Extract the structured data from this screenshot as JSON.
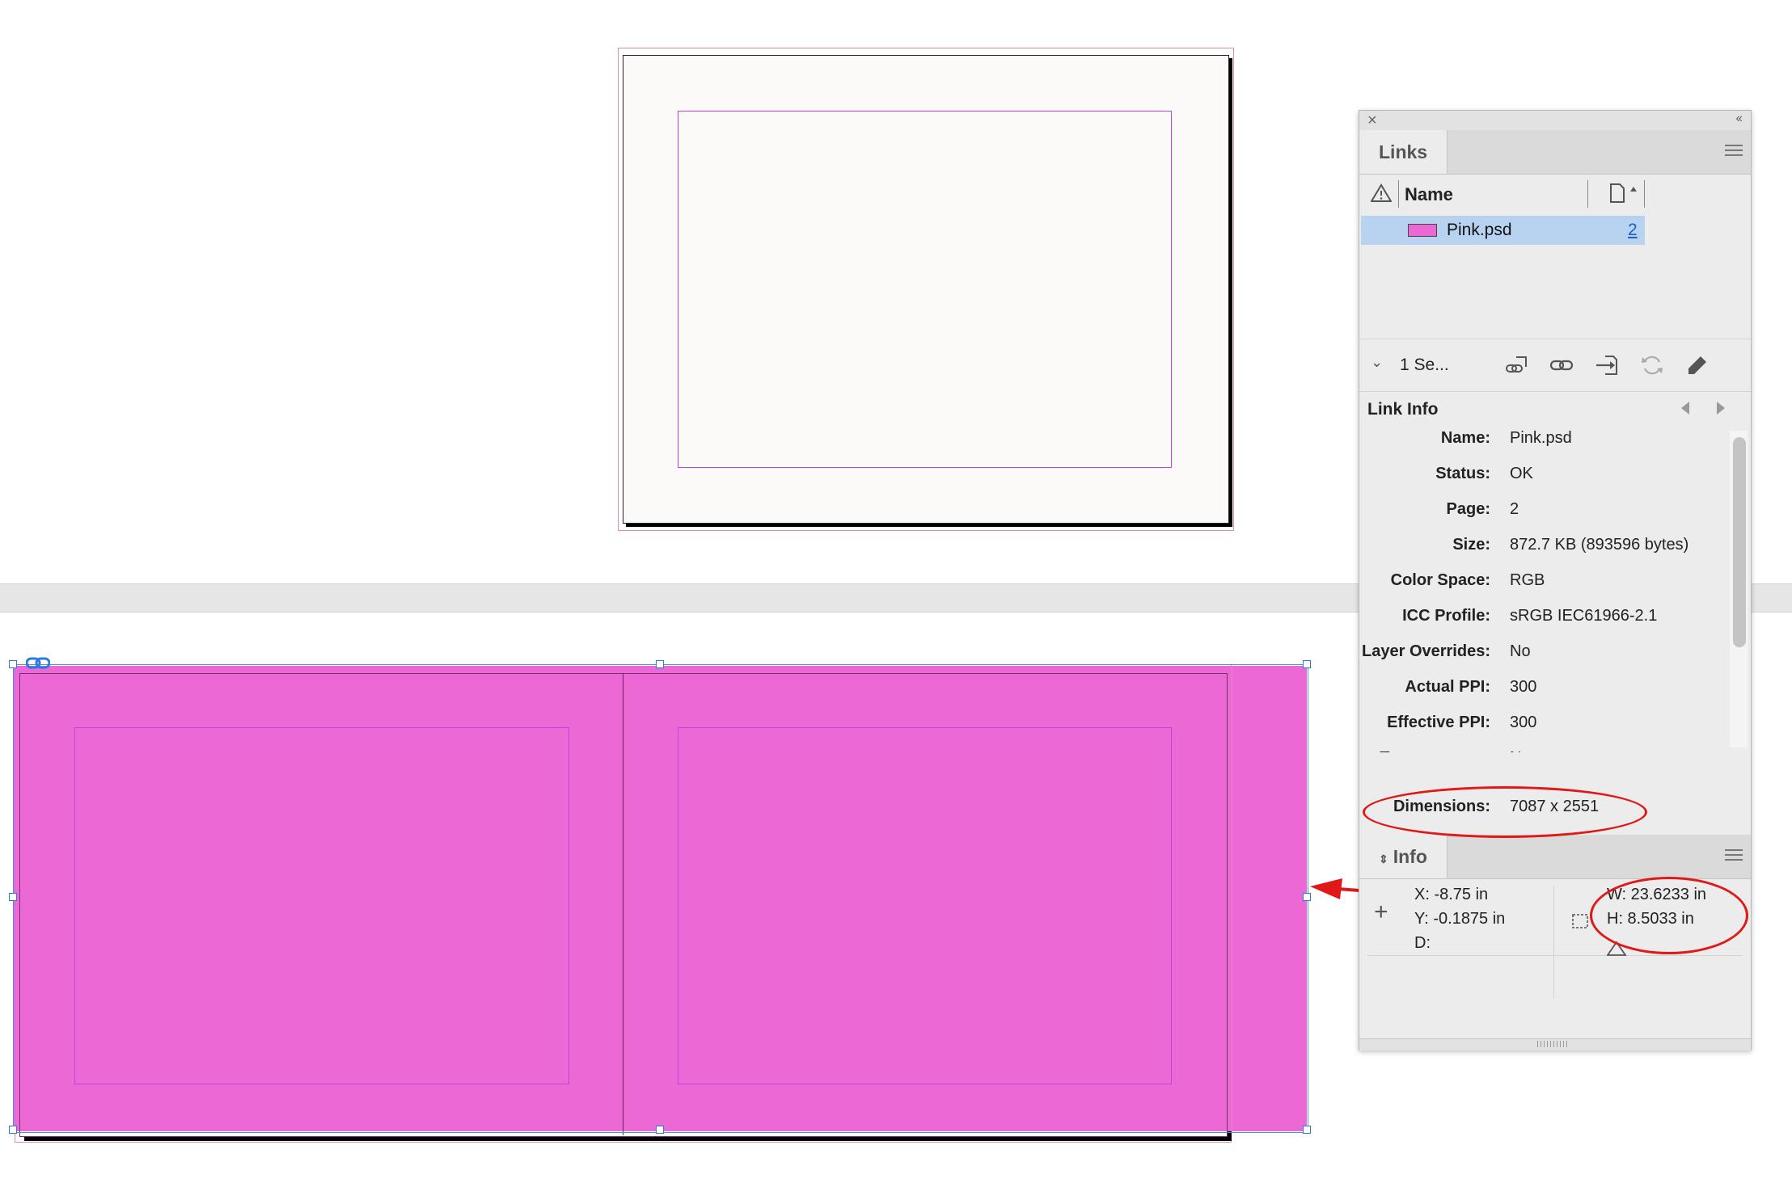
{
  "links_panel": {
    "tab_label": "Links",
    "column_name": "Name",
    "items": [
      {
        "name": "Pink.psd",
        "page": "2",
        "swatch_color": "#ec68d5"
      }
    ],
    "selection_label": "1 Se..."
  },
  "link_info": {
    "title": "Link Info",
    "rows": [
      {
        "key": "Name:",
        "value": "Pink.psd"
      },
      {
        "key": "Status:",
        "value": "OK"
      },
      {
        "key": "Page:",
        "value": "2"
      },
      {
        "key": "Size:",
        "value": "872.7 KB (893596 bytes)"
      },
      {
        "key": "Color Space:",
        "value": "RGB"
      },
      {
        "key": "ICC Profile:",
        "value": "sRGB IEC61966-2.1"
      },
      {
        "key": "Layer Overrides:",
        "value": "No"
      },
      {
        "key": "Actual PPI:",
        "value": "300"
      },
      {
        "key": "Effective PPI:",
        "value": "300"
      },
      {
        "key": "Transparency:",
        "value": "No"
      },
      {
        "key": "Dimensions:",
        "value": "7087 x 2551"
      }
    ]
  },
  "info_panel": {
    "tab_label": "Info",
    "x": "X: -8.75 in",
    "y": "Y: -0.1875 in",
    "d": "D:",
    "w": "W: 23.6233 in",
    "h": "H: 8.5033 in"
  },
  "colors": {
    "image_fill": "#ec68d5",
    "annotation": "#e01818",
    "selection": "#b7d3f0",
    "frame_selection": "#4a8de8"
  }
}
